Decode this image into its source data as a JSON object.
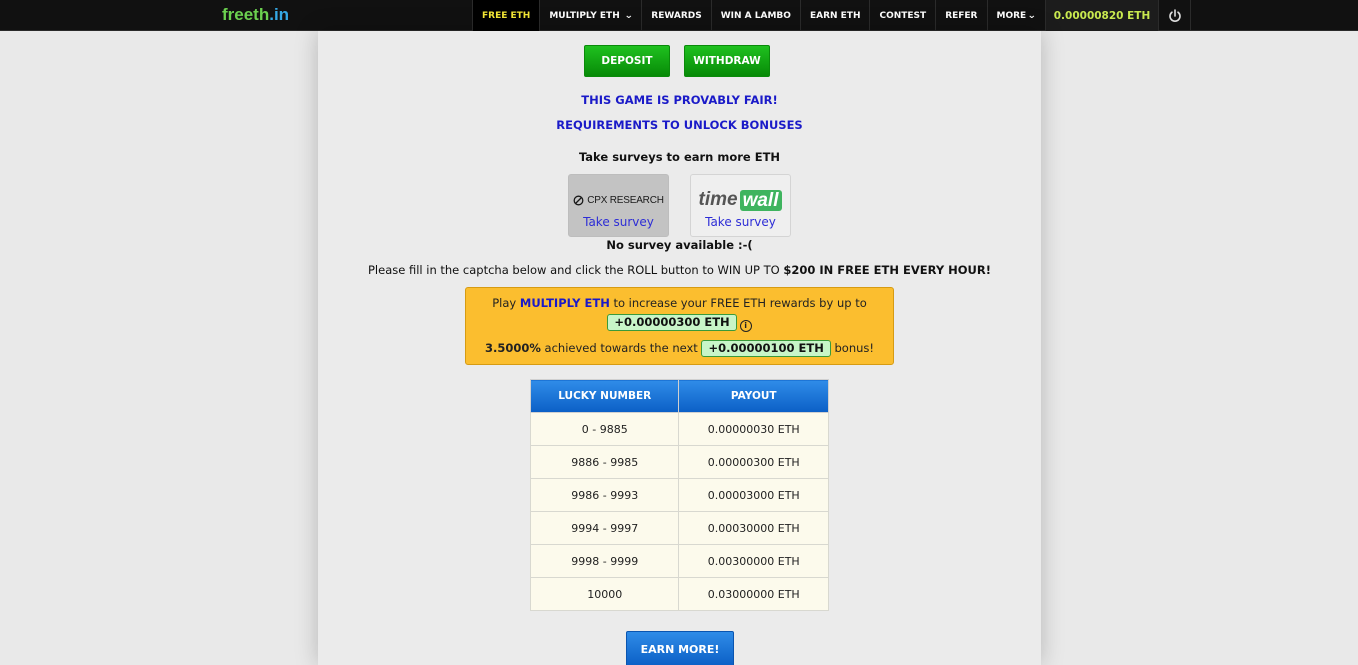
{
  "brand": {
    "part1": "freeth",
    "part2": ".in"
  },
  "nav": {
    "items": [
      {
        "label": "FREE ETH",
        "active": true,
        "dropdown": false
      },
      {
        "label": "MULTIPLY ETH",
        "active": false,
        "dropdown": true
      },
      {
        "label": "REWARDS",
        "active": false,
        "dropdown": false
      },
      {
        "label": "WIN A LAMBO",
        "active": false,
        "dropdown": false
      },
      {
        "label": "EARN ETH",
        "active": false,
        "dropdown": false
      },
      {
        "label": "CONTEST",
        "active": false,
        "dropdown": false
      },
      {
        "label": "REFER",
        "active": false,
        "dropdown": false
      },
      {
        "label": "MORE",
        "active": false,
        "dropdown": true
      }
    ],
    "chevron": "»",
    "balance": "0.00000820 ETH",
    "power_icon": "power-icon"
  },
  "actions": {
    "deposit": "DEPOSIT",
    "withdraw": "WITHDRAW"
  },
  "links": {
    "provably_fair": "THIS GAME IS PROVABLY FAIR!",
    "requirements": "REQUIREMENTS TO UNLOCK BONUSES"
  },
  "surveys": {
    "heading": "Take surveys to earn more ETH",
    "providers": [
      {
        "name": "CPX RESEARCH",
        "link": "Take survey"
      },
      {
        "name_part1": "time",
        "name_part2": "wall",
        "link": "Take survey"
      }
    ],
    "status": "No survey available :-("
  },
  "instructions": {
    "text": "Please fill in the captcha below and click the ROLL button to WIN UP TO ",
    "bold": "$200 IN FREE ETH EVERY HOUR!"
  },
  "bonus": {
    "line1_prefix": "Play ",
    "line1_link": "MULTIPLY ETH",
    "line1_suffix": " to increase your FREE ETH rewards by up to",
    "max_bonus": "+0.00000300 ETH",
    "info_icon": "i",
    "progress_percent": "3.5000%",
    "line3_mid": " achieved towards the next ",
    "next_bonus": "+0.00000100 ETH",
    "line3_suffix": " bonus!"
  },
  "payout_table": {
    "headers": [
      "LUCKY NUMBER",
      "PAYOUT"
    ],
    "rows": [
      [
        "0 - 9885",
        "0.00000030 ETH"
      ],
      [
        "9886 - 9985",
        "0.00000300 ETH"
      ],
      [
        "9986 - 9993",
        "0.00003000 ETH"
      ],
      [
        "9994 - 9997",
        "0.00030000 ETH"
      ],
      [
        "9998 - 9999",
        "0.00300000 ETH"
      ],
      [
        "10000",
        "0.03000000 ETH"
      ]
    ]
  },
  "earn_more": "EARN MORE!"
}
